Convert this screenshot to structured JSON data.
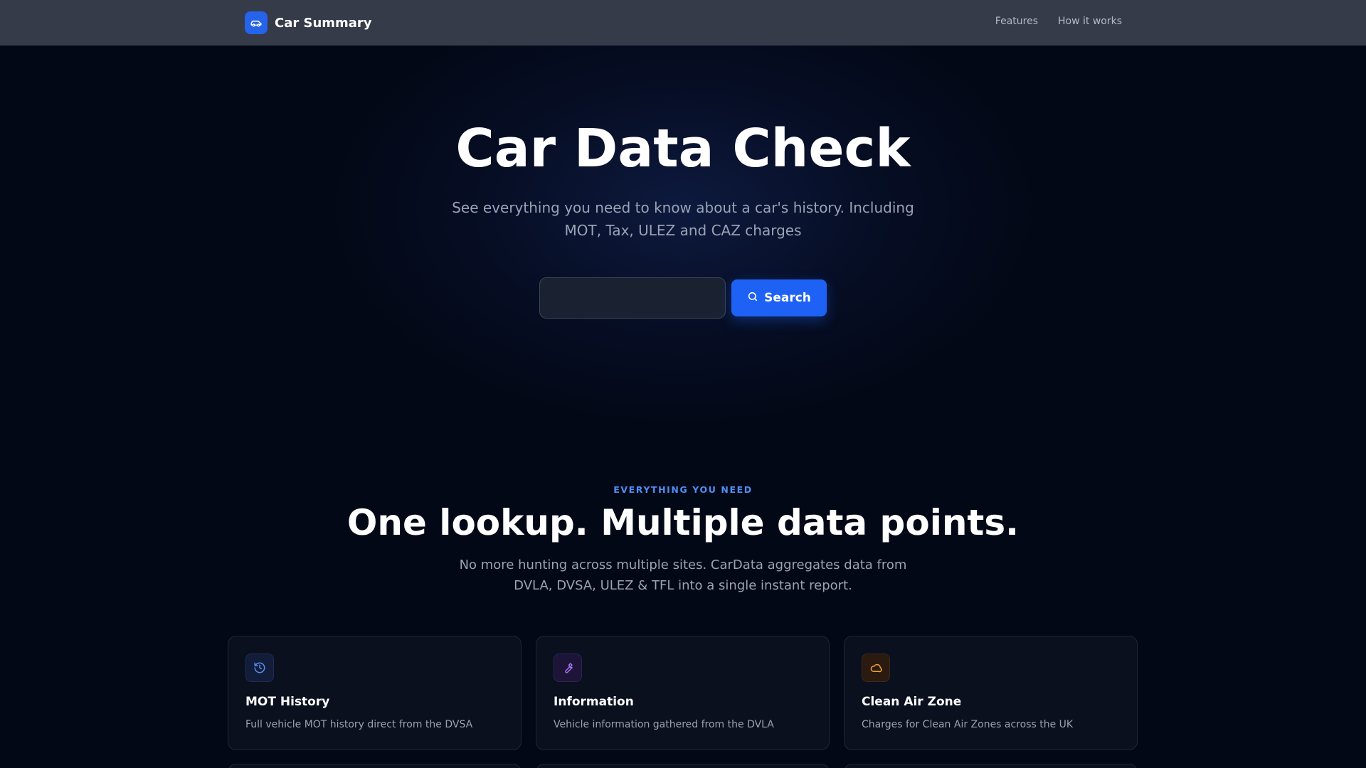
{
  "header": {
    "brand": "Car Summary",
    "nav": [
      "Features",
      "How it works"
    ]
  },
  "hero": {
    "title": "Car Data Check",
    "subtitle": "See everything you need to know about a car's history. Including MOT, Tax, ULEZ and CAZ charges",
    "search_value": "",
    "search_button": "Search"
  },
  "features": {
    "eyebrow": "EVERYTHING YOU NEED",
    "title": "One lookup. Multiple data points.",
    "subtitle": "No more hunting across multiple sites. CarData aggregates data from DVLA, DVSA, ULEZ & TFL into a single instant report.",
    "cards": [
      {
        "title": "MOT History",
        "desc": "Full vehicle MOT history direct from the DVSA",
        "icon": "history-icon",
        "color": "#5b8def"
      },
      {
        "title": "Information",
        "desc": "Vehicle information gathered from the DVLA",
        "icon": "wrench-icon",
        "color": "#a774f2"
      },
      {
        "title": "Clean Air Zone",
        "desc": "Charges for Clean Air Zones across the UK",
        "icon": "cloud-icon",
        "color": "#f0a43c"
      }
    ]
  },
  "colors": {
    "accent": "#1e62f5",
    "background": "#030816",
    "header": "#363b4a"
  }
}
